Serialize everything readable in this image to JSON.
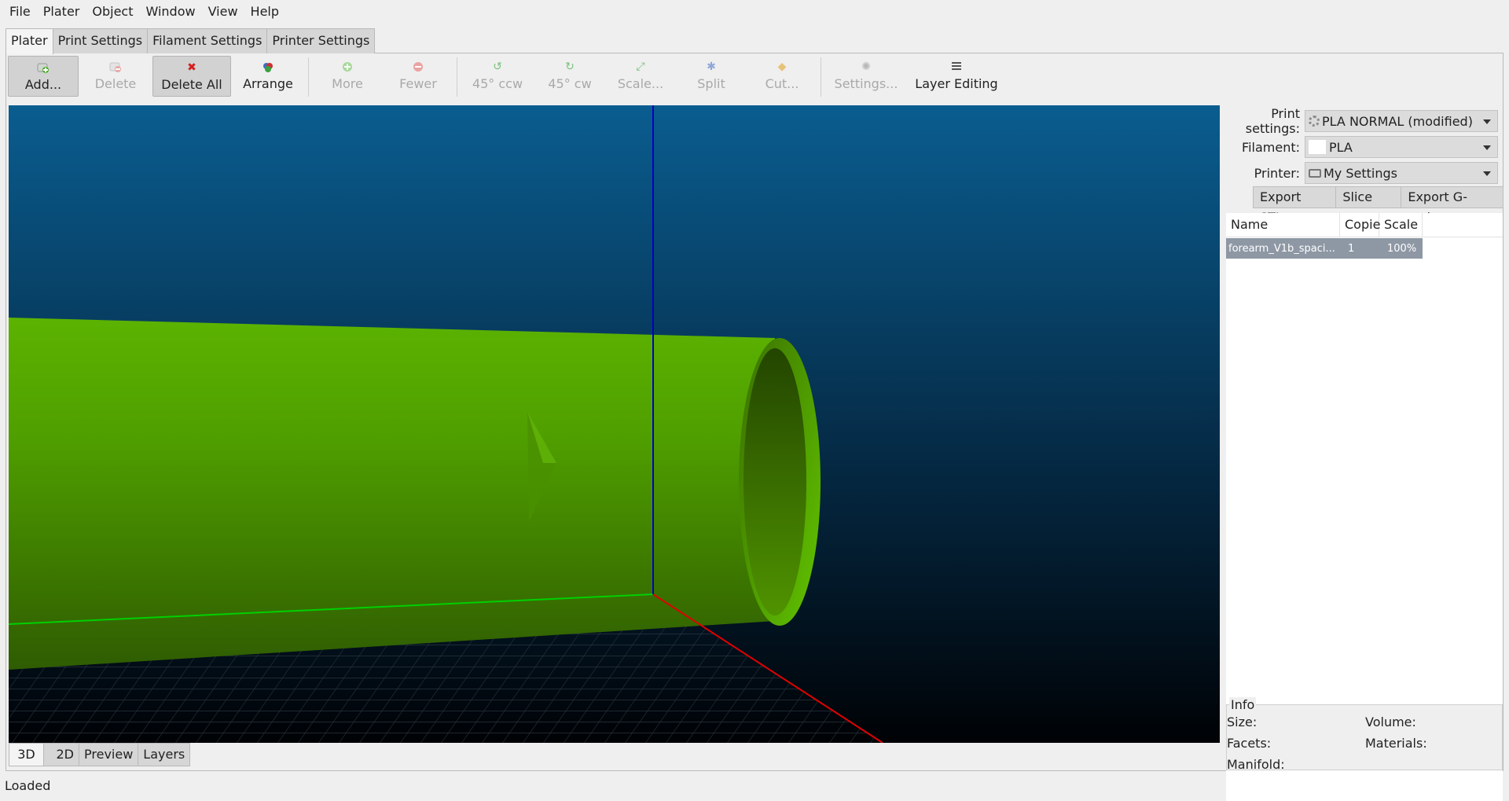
{
  "menu": [
    "File",
    "Plater",
    "Object",
    "Window",
    "View",
    "Help"
  ],
  "tabs": [
    "Plater",
    "Print Settings",
    "Filament Settings",
    "Printer Settings"
  ],
  "toolbar": {
    "add": "Add...",
    "delete": "Delete",
    "delete_all": "Delete All",
    "arrange": "Arrange",
    "more": "More",
    "fewer": "Fewer",
    "rotate_ccw": "45° ccw",
    "rotate_cw": "45° cw",
    "scale": "Scale...",
    "split": "Split",
    "cut": "Cut...",
    "settings": "Settings...",
    "layer_editing": "Layer Editing"
  },
  "view_tabs": [
    "3D",
    "2D",
    "Preview",
    "Layers"
  ],
  "panel": {
    "print_settings_label": "Print settings:",
    "print_settings_value": "PLA NORMAL (modified)",
    "filament_label": "Filament:",
    "filament_value": "PLA",
    "printer_label": "Printer:",
    "printer_value": "My Settings",
    "export_stl": "Export STL...",
    "slice_now": "Slice now",
    "export_gcode": "Export G-code..."
  },
  "objects_table": {
    "columns": [
      "Name",
      "Copie",
      "Scale"
    ],
    "rows": [
      {
        "name": "forearm_V1b_spaci...",
        "copies": "1",
        "scale": "100%"
      }
    ]
  },
  "info": {
    "title": "Info",
    "size": "Size:",
    "volume": "Volume:",
    "facets": "Facets:",
    "materials": "Materials:",
    "manifold": "Manifold:"
  },
  "status": "Loaded",
  "colors": {
    "model_green": "#5cb300",
    "viewport_top": "#0a5d90",
    "viewport_bottom": "#000205",
    "axis_x": "#e00000",
    "axis_y": "#00d000",
    "axis_z": "#0000c8"
  }
}
